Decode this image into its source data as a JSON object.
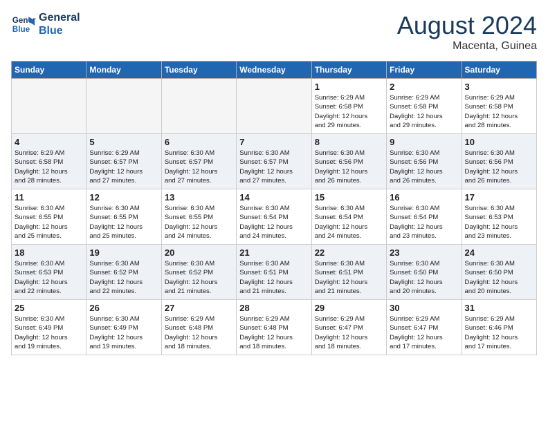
{
  "header": {
    "logo_line1": "General",
    "logo_line2": "Blue",
    "month": "August 2024",
    "location": "Macenta, Guinea"
  },
  "weekdays": [
    "Sunday",
    "Monday",
    "Tuesday",
    "Wednesday",
    "Thursday",
    "Friday",
    "Saturday"
  ],
  "weeks": [
    [
      {
        "day": "",
        "info": ""
      },
      {
        "day": "",
        "info": ""
      },
      {
        "day": "",
        "info": ""
      },
      {
        "day": "",
        "info": ""
      },
      {
        "day": "1",
        "info": "Sunrise: 6:29 AM\nSunset: 6:58 PM\nDaylight: 12 hours\nand 29 minutes."
      },
      {
        "day": "2",
        "info": "Sunrise: 6:29 AM\nSunset: 6:58 PM\nDaylight: 12 hours\nand 29 minutes."
      },
      {
        "day": "3",
        "info": "Sunrise: 6:29 AM\nSunset: 6:58 PM\nDaylight: 12 hours\nand 28 minutes."
      }
    ],
    [
      {
        "day": "4",
        "info": "Sunrise: 6:29 AM\nSunset: 6:58 PM\nDaylight: 12 hours\nand 28 minutes."
      },
      {
        "day": "5",
        "info": "Sunrise: 6:29 AM\nSunset: 6:57 PM\nDaylight: 12 hours\nand 27 minutes."
      },
      {
        "day": "6",
        "info": "Sunrise: 6:30 AM\nSunset: 6:57 PM\nDaylight: 12 hours\nand 27 minutes."
      },
      {
        "day": "7",
        "info": "Sunrise: 6:30 AM\nSunset: 6:57 PM\nDaylight: 12 hours\nand 27 minutes."
      },
      {
        "day": "8",
        "info": "Sunrise: 6:30 AM\nSunset: 6:56 PM\nDaylight: 12 hours\nand 26 minutes."
      },
      {
        "day": "9",
        "info": "Sunrise: 6:30 AM\nSunset: 6:56 PM\nDaylight: 12 hours\nand 26 minutes."
      },
      {
        "day": "10",
        "info": "Sunrise: 6:30 AM\nSunset: 6:56 PM\nDaylight: 12 hours\nand 26 minutes."
      }
    ],
    [
      {
        "day": "11",
        "info": "Sunrise: 6:30 AM\nSunset: 6:55 PM\nDaylight: 12 hours\nand 25 minutes."
      },
      {
        "day": "12",
        "info": "Sunrise: 6:30 AM\nSunset: 6:55 PM\nDaylight: 12 hours\nand 25 minutes."
      },
      {
        "day": "13",
        "info": "Sunrise: 6:30 AM\nSunset: 6:55 PM\nDaylight: 12 hours\nand 24 minutes."
      },
      {
        "day": "14",
        "info": "Sunrise: 6:30 AM\nSunset: 6:54 PM\nDaylight: 12 hours\nand 24 minutes."
      },
      {
        "day": "15",
        "info": "Sunrise: 6:30 AM\nSunset: 6:54 PM\nDaylight: 12 hours\nand 24 minutes."
      },
      {
        "day": "16",
        "info": "Sunrise: 6:30 AM\nSunset: 6:54 PM\nDaylight: 12 hours\nand 23 minutes."
      },
      {
        "day": "17",
        "info": "Sunrise: 6:30 AM\nSunset: 6:53 PM\nDaylight: 12 hours\nand 23 minutes."
      }
    ],
    [
      {
        "day": "18",
        "info": "Sunrise: 6:30 AM\nSunset: 6:53 PM\nDaylight: 12 hours\nand 22 minutes."
      },
      {
        "day": "19",
        "info": "Sunrise: 6:30 AM\nSunset: 6:52 PM\nDaylight: 12 hours\nand 22 minutes."
      },
      {
        "day": "20",
        "info": "Sunrise: 6:30 AM\nSunset: 6:52 PM\nDaylight: 12 hours\nand 21 minutes."
      },
      {
        "day": "21",
        "info": "Sunrise: 6:30 AM\nSunset: 6:51 PM\nDaylight: 12 hours\nand 21 minutes."
      },
      {
        "day": "22",
        "info": "Sunrise: 6:30 AM\nSunset: 6:51 PM\nDaylight: 12 hours\nand 21 minutes."
      },
      {
        "day": "23",
        "info": "Sunrise: 6:30 AM\nSunset: 6:50 PM\nDaylight: 12 hours\nand 20 minutes."
      },
      {
        "day": "24",
        "info": "Sunrise: 6:30 AM\nSunset: 6:50 PM\nDaylight: 12 hours\nand 20 minutes."
      }
    ],
    [
      {
        "day": "25",
        "info": "Sunrise: 6:30 AM\nSunset: 6:49 PM\nDaylight: 12 hours\nand 19 minutes."
      },
      {
        "day": "26",
        "info": "Sunrise: 6:30 AM\nSunset: 6:49 PM\nDaylight: 12 hours\nand 19 minutes."
      },
      {
        "day": "27",
        "info": "Sunrise: 6:29 AM\nSunset: 6:48 PM\nDaylight: 12 hours\nand 18 minutes."
      },
      {
        "day": "28",
        "info": "Sunrise: 6:29 AM\nSunset: 6:48 PM\nDaylight: 12 hours\nand 18 minutes."
      },
      {
        "day": "29",
        "info": "Sunrise: 6:29 AM\nSunset: 6:47 PM\nDaylight: 12 hours\nand 18 minutes."
      },
      {
        "day": "30",
        "info": "Sunrise: 6:29 AM\nSunset: 6:47 PM\nDaylight: 12 hours\nand 17 minutes."
      },
      {
        "day": "31",
        "info": "Sunrise: 6:29 AM\nSunset: 6:46 PM\nDaylight: 12 hours\nand 17 minutes."
      }
    ]
  ]
}
